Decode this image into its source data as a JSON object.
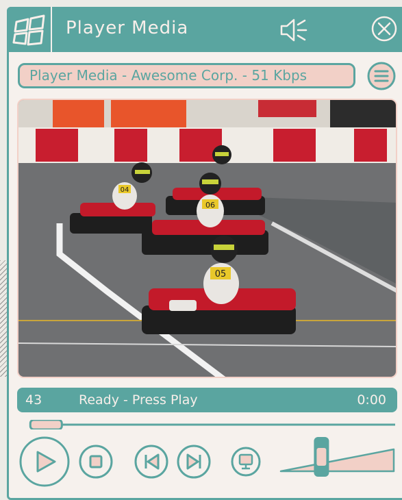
{
  "window": {
    "title": "Player Media"
  },
  "address_bar": {
    "text": "Player Media - Awesome Corp. - 51 Kbps"
  },
  "status_bar": {
    "number": "43",
    "message": "Ready - Press Play",
    "time": "0:00"
  },
  "playback": {
    "progress": 0.04,
    "volume": 0.36
  },
  "video": {
    "kart_numbers": [
      "04",
      "06",
      "05"
    ],
    "scene": "go-kart race"
  },
  "colors": {
    "teal": "#5aa5a0",
    "pink": "#f2d0c7",
    "bg": "#f6f1ed"
  },
  "icons": [
    "windows-logo-icon",
    "speaker-muted-icon",
    "close-icon",
    "menu-icon",
    "play-icon",
    "stop-icon",
    "previous-icon",
    "next-icon",
    "screen-icon"
  ]
}
